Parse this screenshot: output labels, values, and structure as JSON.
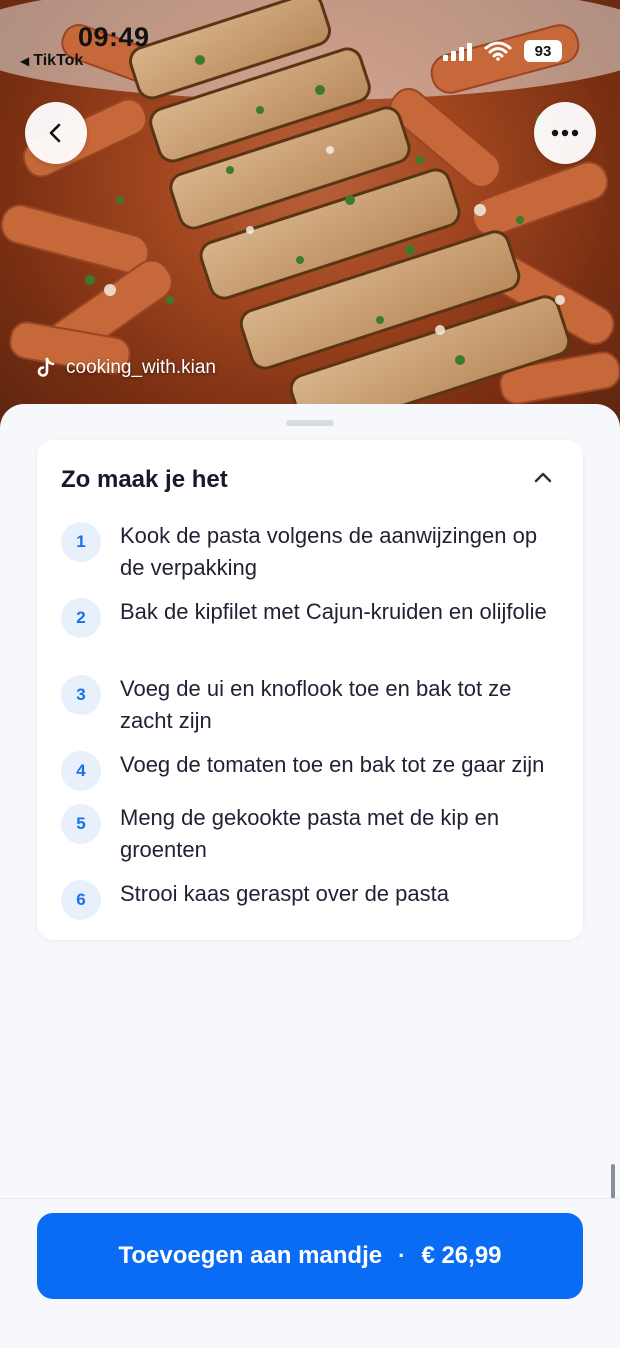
{
  "status_bar": {
    "time": "09:49",
    "back_app": "TikTok",
    "battery": "93"
  },
  "hero": {
    "credit": "cooking_with.kian"
  },
  "instructions": {
    "title": "Zo maak je het",
    "steps": [
      {
        "num": "1",
        "text": "Kook de pasta volgens de aanwijzingen op de verpakking"
      },
      {
        "num": "2",
        "text": "Bak de kipfilet met Cajun-kruiden en olijfolie"
      },
      {
        "num": "3",
        "text": "Voeg de ui en knoflook toe en bak tot ze zacht zijn"
      },
      {
        "num": "4",
        "text": "Voeg de tomaten toe en bak tot ze gaar zijn"
      },
      {
        "num": "5",
        "text": "Meng de gekookte pasta met de kip en groenten"
      },
      {
        "num": "6",
        "text": "Strooi kaas geraspt over de pasta"
      }
    ]
  },
  "footer": {
    "cta_label": "Toevoegen aan mandje",
    "separator": "·",
    "price": "€ 26,99"
  },
  "colors": {
    "accent": "#0a6cf5",
    "step_badge_bg": "#e8f0fc",
    "step_badge_text": "#1572e8"
  },
  "icons": [
    "back-arrow-icon",
    "more-icon",
    "tiktok-icon",
    "chevron-up-icon",
    "signal-icon",
    "wifi-icon",
    "battery-icon"
  ]
}
